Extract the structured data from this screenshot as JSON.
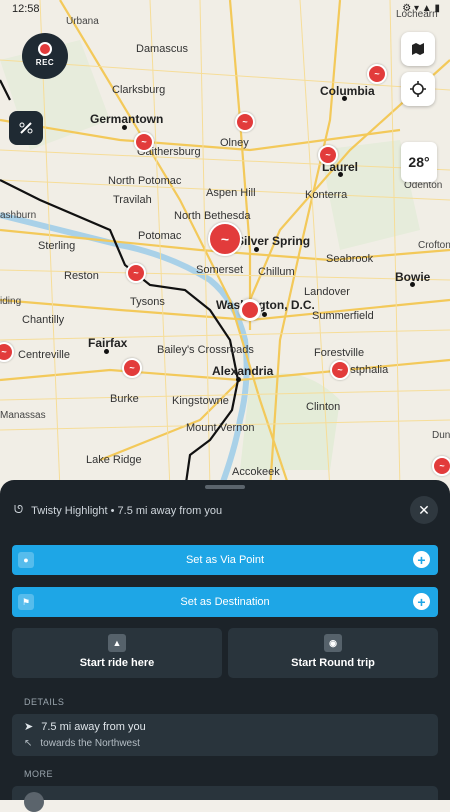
{
  "status": {
    "time": "12:58",
    "icons": "⚙ ▾ ▲ ▮"
  },
  "map": {
    "places_big": [
      {
        "name": "Germantown"
      },
      {
        "name": "Columbia"
      },
      {
        "name": "Laurel"
      },
      {
        "name": "Bowie"
      },
      {
        "name": "Fairfax"
      },
      {
        "name": "Alexandria"
      },
      {
        "name": "Washington, D.C."
      },
      {
        "name": "Silver Spring"
      }
    ],
    "places_med": [
      {
        "name": "Damascus"
      },
      {
        "name": "Clarksburg"
      },
      {
        "name": "Gaithersburg"
      },
      {
        "name": "Olney"
      },
      {
        "name": "North Potomac"
      },
      {
        "name": "Aspen Hill"
      },
      {
        "name": "Travilah"
      },
      {
        "name": "North Bethesda"
      },
      {
        "name": "Potomac"
      },
      {
        "name": "Sterling"
      },
      {
        "name": "Reston"
      },
      {
        "name": "Somerset"
      },
      {
        "name": "Chillum"
      },
      {
        "name": "Konterra"
      },
      {
        "name": "Seabrook"
      },
      {
        "name": "Tysons"
      },
      {
        "name": "Landover"
      },
      {
        "name": "Chantilly"
      },
      {
        "name": "Summerfield"
      },
      {
        "name": "Bailey's Crossroads"
      },
      {
        "name": "Centreville"
      },
      {
        "name": "Forestville"
      },
      {
        "name": "Westphalia"
      },
      {
        "name": "Burke"
      },
      {
        "name": "Kingstowne"
      },
      {
        "name": "Clinton"
      },
      {
        "name": "Mount Vernon"
      },
      {
        "name": "Lake Ridge"
      },
      {
        "name": "Accokeek"
      },
      {
        "name": "Urbana"
      },
      {
        "name": "Odenton"
      },
      {
        "name": "Crofton"
      },
      {
        "name": "Lochearn"
      },
      {
        "name": "ashburn"
      },
      {
        "name": "iding"
      },
      {
        "name": "Manassas"
      },
      {
        "name": "Dun"
      }
    ]
  },
  "controls": {
    "rec_label": "REC",
    "temperature": "28°"
  },
  "sheet": {
    "title": "Twisty Highlight • 7.5 mi away from you",
    "via_label": "Set as Via Point",
    "dest_label": "Set as Destination",
    "start_ride_label": "Start ride here",
    "round_trip_label": "Start Round trip",
    "details_heading": "DETAILS",
    "distance_text": "7.5 mi away from you",
    "direction_text": "towards the Northwest",
    "more_heading": "MORE"
  }
}
